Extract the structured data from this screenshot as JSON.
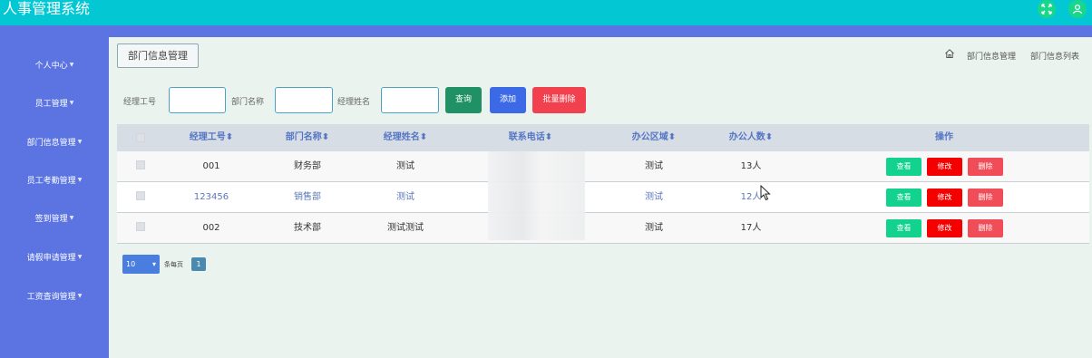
{
  "app": {
    "title": "人事管理系统",
    "colors": {
      "header": "#03c8d4",
      "sidebar": "#5b74e2",
      "accent_green": "#12d28e",
      "danger": "#f40000"
    },
    "header_icons": [
      "fullscreen-icon",
      "user-icon"
    ]
  },
  "sidebar": {
    "items": [
      {
        "label": "个人中心"
      },
      {
        "label": "员工管理"
      },
      {
        "label": "部门信息管理"
      },
      {
        "label": "员工考勤管理"
      },
      {
        "label": "签到管理"
      },
      {
        "label": "请假申请管理"
      },
      {
        "label": "工资查询管理"
      }
    ]
  },
  "page": {
    "title": "部门信息管理",
    "breadcrumb": [
      "部门信息管理",
      "部门信息列表"
    ]
  },
  "filters": {
    "manager_id_label": "经理工号",
    "dept_name_label": "部门名称",
    "manager_name_label": "经理姓名",
    "manager_id_value": "",
    "dept_name_value": "",
    "manager_name_value": ""
  },
  "buttons": {
    "query": "查询",
    "add": "添加",
    "batch_delete": "批量删除"
  },
  "table": {
    "headers": [
      "经理工号",
      "部门名称",
      "经理姓名",
      "联系电话",
      "办公区域",
      "办公人数",
      "操作"
    ],
    "sort_icon": "sort-icon",
    "rows": [
      {
        "manager_id": "001",
        "dept_name": "财务部",
        "manager_name": "测试",
        "phone": "",
        "area": "测试",
        "count": "13人"
      },
      {
        "manager_id": "123456",
        "dept_name": "销售部",
        "manager_name": "测试",
        "phone": "",
        "area": "测试",
        "count": "12人"
      },
      {
        "manager_id": "002",
        "dept_name": "技术部",
        "manager_name": "测试测试",
        "phone": "",
        "area": "测试",
        "count": "17人"
      }
    ],
    "actions": {
      "view": "查看",
      "edit": "修改",
      "delete": "删除"
    }
  },
  "pager": {
    "page_size": "10",
    "per_page_label": "条每页",
    "current_page": "1"
  }
}
